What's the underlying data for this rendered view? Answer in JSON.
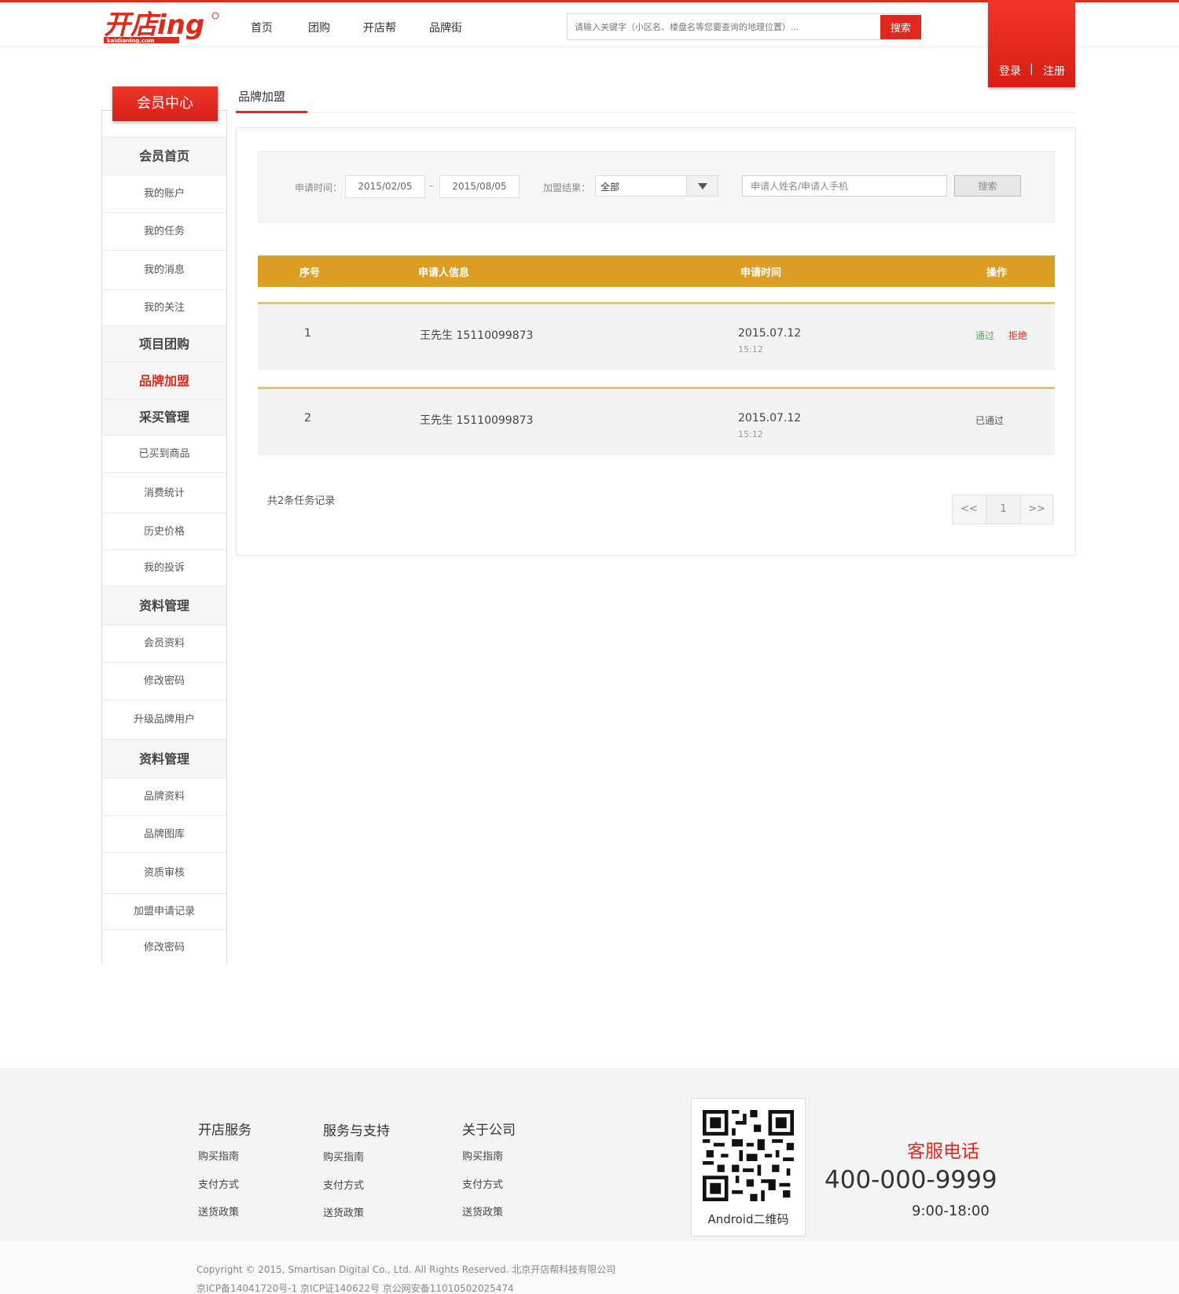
{
  "header": {
    "logo_text": "开店ing",
    "logo_sub": "kaidianing.com",
    "nav": [
      "首页",
      "团购",
      "开店帮",
      "品牌街"
    ],
    "search_placeholder": "请输入关键字（小区名、楼盘名等您要查询的地理位置）...",
    "search_label": "搜索",
    "login_label": "登录",
    "separator": "|",
    "register_label": "注册"
  },
  "sidebar": {
    "title": "会员中心",
    "items": [
      {
        "label": "会员首页",
        "type": "head"
      },
      {
        "label": "我的账户",
        "type": "item"
      },
      {
        "label": "我的任务",
        "type": "item"
      },
      {
        "label": "我的消息",
        "type": "item"
      },
      {
        "label": "我的关注",
        "type": "item"
      },
      {
        "label": "项目团购",
        "type": "head"
      },
      {
        "label": "品牌加盟",
        "type": "head-active"
      },
      {
        "label": "采买管理",
        "type": "head"
      },
      {
        "label": "已买到商品",
        "type": "item"
      },
      {
        "label": "消费统计",
        "type": "item"
      },
      {
        "label": "历史价格",
        "type": "item"
      },
      {
        "label": "我的投诉",
        "type": "item"
      },
      {
        "label": "资料管理",
        "type": "head"
      },
      {
        "label": "会员资料",
        "type": "item"
      },
      {
        "label": "修改密码",
        "type": "item"
      },
      {
        "label": "升级品牌用户",
        "type": "item"
      },
      {
        "label": "资料管理",
        "type": "head"
      },
      {
        "label": "品牌资料",
        "type": "item"
      },
      {
        "label": "品牌图库",
        "type": "item"
      },
      {
        "label": "资质审核",
        "type": "item"
      },
      {
        "label": "加盟申请记录",
        "type": "item"
      },
      {
        "label": "修改密码",
        "type": "item"
      }
    ]
  },
  "main": {
    "tab_label": "品牌加盟",
    "filter": {
      "date_label": "申请时间：",
      "date_from": "2015/02/05",
      "date_dash": "–",
      "date_to": "2015/08/05",
      "result_label": "加盟结果：",
      "result_value": "全部",
      "keyword_placeholder": "申请人姓名/申请人手机",
      "search_label": "搜索"
    },
    "table": {
      "headers": [
        "序号",
        "申请人信息",
        "申请时间",
        "操作"
      ],
      "rows": [
        {
          "index": "1",
          "applicant": "王先生  15110099873",
          "date": "2015.07.12",
          "time": "15:12",
          "pass_label": "通过",
          "reject_label": "拒绝",
          "status": ""
        },
        {
          "index": "2",
          "applicant": "王先生  15110099873",
          "date": "2015.07.12",
          "time": "15:12",
          "pass_label": "",
          "reject_label": "",
          "status": "已通过"
        }
      ]
    },
    "total_text": "共2条任务记录",
    "pager": {
      "prev": "<<",
      "current": "1",
      "next": ">>"
    }
  },
  "footer": {
    "columns": [
      {
        "title": "开店服务",
        "links": [
          "购买指南",
          "支付方式",
          "送货政策"
        ]
      },
      {
        "title": "服务与支持",
        "links": [
          "购买指南",
          "支付方式",
          "送货政策"
        ]
      },
      {
        "title": "关于公司",
        "links": [
          "购买指南",
          "支付方式",
          "送货政策"
        ]
      }
    ],
    "qr_label": "Android二维码",
    "hotline_title": "客服电话",
    "hotline_number": "400-000-9999",
    "hotline_hours": "9:00-18:00",
    "copyright": "Copyright © 2015, Smartisan Digital Co., Ltd. All Rights Reserved. 北京开店帮科技有限公司",
    "icp": "京ICP备14041720号-1 京ICP证140622号 京公网安备11010502025474"
  },
  "colors": {
    "brand_red": "#e0291b",
    "table_header": "#dc9e22",
    "row_rule": "#dcc588",
    "pass_green": "#4caf50"
  }
}
